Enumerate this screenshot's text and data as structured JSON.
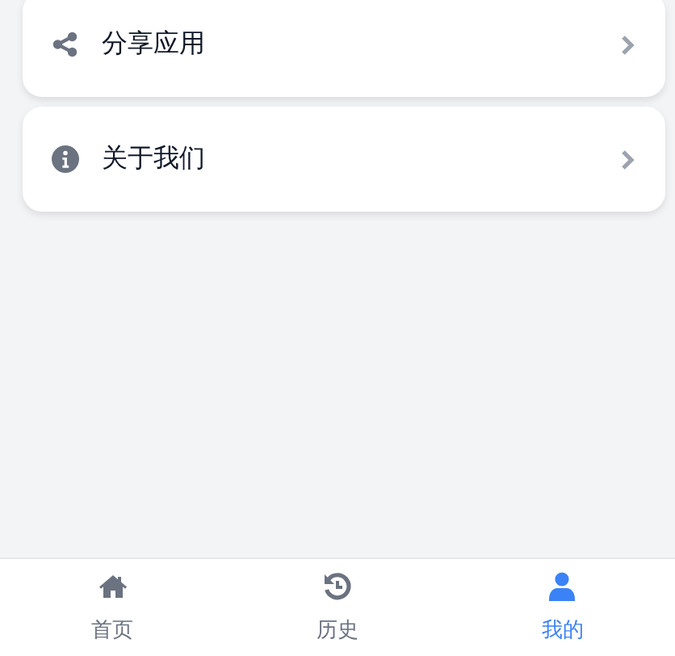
{
  "menu": [
    {
      "label": "分享应用"
    },
    {
      "label": "关于我们"
    }
  ],
  "tab_bar": [
    {
      "label": "首页",
      "selected": false
    },
    {
      "label": "历史",
      "selected": false
    },
    {
      "label": "我的",
      "selected": true
    }
  ]
}
